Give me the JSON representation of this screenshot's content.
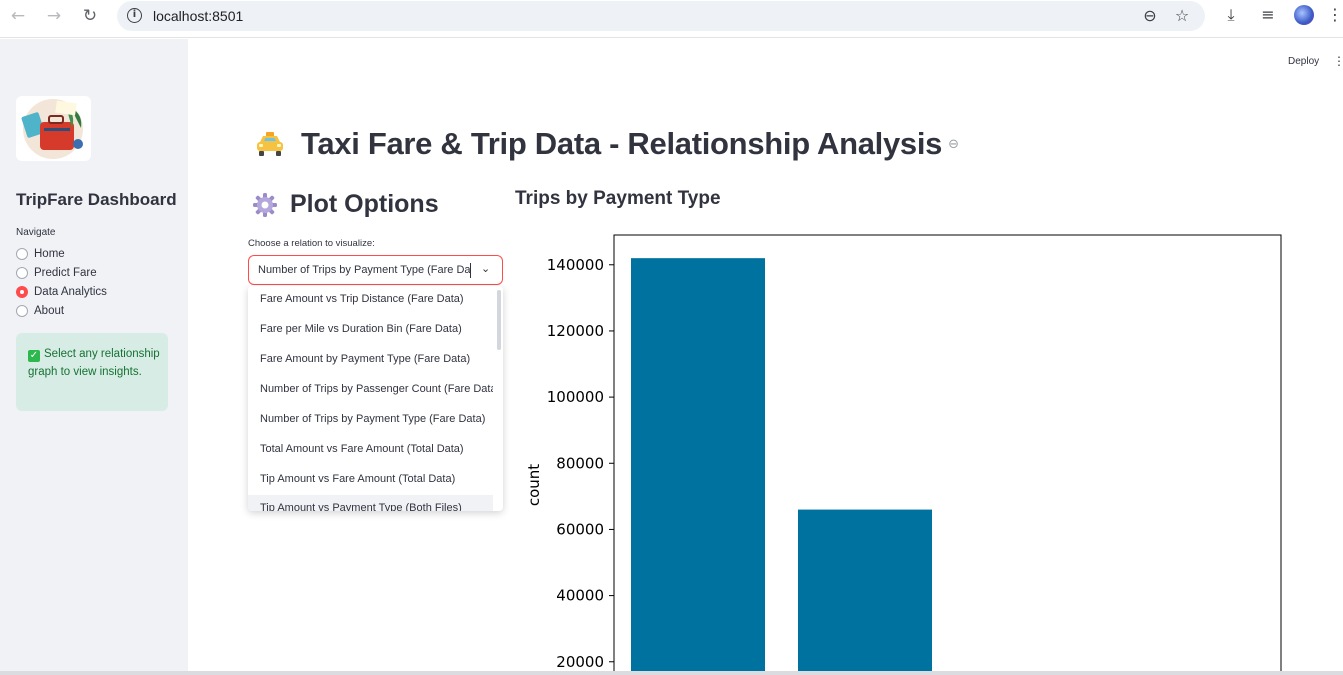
{
  "browser": {
    "url": "localhost:8501"
  },
  "sidebar": {
    "title": "TripFare Dashboard",
    "nav_label": "Navigate",
    "nav_items": [
      {
        "label": "Home",
        "selected": false
      },
      {
        "label": "Predict Fare",
        "selected": false
      },
      {
        "label": "Data Analytics",
        "selected": true
      },
      {
        "label": "About",
        "selected": false
      }
    ],
    "info_text": "Select any relationship graph to view insights."
  },
  "header": {
    "deploy_label": "Deploy"
  },
  "main": {
    "title": "Taxi Fare & Trip Data - Relationship Analysis",
    "plot_options_title": "Plot Options",
    "select_label": "Choose a relation to visualize:",
    "select_value": "Number of Trips by Payment Type (Fare Data)",
    "dropdown_options": [
      "Fare Amount vs Trip Distance (Fare Data)",
      "Fare per Mile vs Duration Bin (Fare Data)",
      "Fare Amount by Payment Type (Fare Data)",
      "Number of Trips by Passenger Count (Fare Data)",
      "Number of Trips by Payment Type (Fare Data)",
      "Total Amount vs Fare Amount (Total Data)",
      "Tip Amount vs Fare Amount (Total Data)",
      "Tip Amount vs Payment Type (Both Files)"
    ],
    "highlighted_option_index": 7,
    "chart_heading": "Trips by Payment Type"
  },
  "colors": {
    "accent": "#ff4b4b",
    "bar": "#0072a0",
    "sidebar_bg": "#f0f2f6",
    "info_bg": "#d6ece4",
    "info_text": "#177233"
  },
  "chart_data": {
    "type": "bar",
    "title": "Trips by Payment Type",
    "xlabel": "",
    "ylabel": "count",
    "values": [
      142000,
      66000
    ],
    "yticks": [
      20000,
      40000,
      60000,
      80000,
      100000,
      120000,
      140000
    ],
    "ylim_visible": [
      16000,
      149000
    ],
    "grid": false
  }
}
